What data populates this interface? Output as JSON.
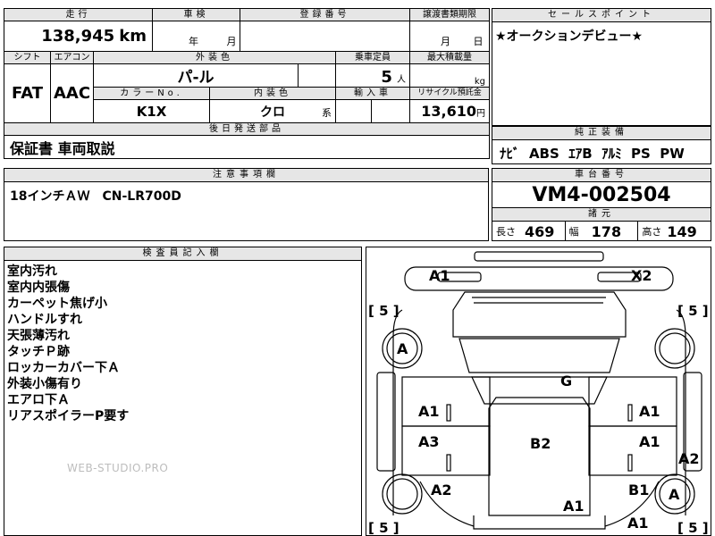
{
  "vehicle": {
    "mileage_label": "走行",
    "mileage_value": "138,945",
    "mileage_unit": "km",
    "inspection_label": "車検",
    "inspection_year_unit": "年",
    "inspection_month_unit": "月",
    "registration_label": "登録番号",
    "transfer_label": "譲渡書類期限",
    "transfer_month_unit": "月",
    "transfer_day_unit": "日",
    "shift_label": "シフト",
    "shift_value": "FAT",
    "ac_label": "エアコン",
    "ac_value": "AAC",
    "exterior_color_label": "外装色",
    "exterior_color_value": "パ-ル",
    "capacity_label": "乗車定員",
    "capacity_value": "5",
    "capacity_unit": "人",
    "max_load_label": "最大積載量",
    "max_load_unit": "kg",
    "color_no_label": "カラーNo.",
    "color_no_value": "K1X",
    "interior_label": "内装色",
    "interior_value": "クロ",
    "interior_suffix": "系",
    "import_label": "輸入車",
    "recycle_label": "リサイクル預託金",
    "recycle_value": "13,610",
    "recycle_unit": "円",
    "later_parts_label": "後日発送部品",
    "later_parts_value": "保証書 車両取説",
    "notes_label": "注意事項欄",
    "notes_value": "18インチＡＷ　CN-LR700D"
  },
  "sales_point": {
    "label": "セールスポイント",
    "text": "★オークションデビュー★"
  },
  "equipment": {
    "label": "純正装備",
    "text": "ﾅﾋﾞ  ABS  ｴｱB  ｱﾙﾐ  PS  PW"
  },
  "chassis": {
    "label": "車台番号",
    "value": "VM4-002504"
  },
  "dimensions": {
    "label": "諸元",
    "length_label": "長さ",
    "length_value": "469",
    "width_label": "幅",
    "width_value": "178",
    "height_label": "高さ",
    "height_value": "149"
  },
  "inspector": {
    "label": "検査員記入欄",
    "lines": [
      "室内汚れ",
      "室内内張傷",
      "カーペット焦げ小",
      "ハンドルすれ",
      "天張薄汚れ",
      "タッチＰ跡",
      "ロッカーカバー下Ａ",
      "外装小傷有り",
      "エアロ下Ａ",
      "リアスポイラーP要す"
    ],
    "watermark": "WEB-STUDIO.PRO"
  },
  "damage_map": {
    "front_left": "A1",
    "front_right": "X2",
    "tire_bracket": "[ 5 ]",
    "left_front_wheel": "A",
    "hood": "G",
    "left_front_door": "A1",
    "right_front_door": "A1",
    "left_rear_door": "A3",
    "right_rear_door": "A1",
    "roof": "B2",
    "right_rear_side": "A2",
    "left_rear_fender": "A2",
    "right_rear_fender": "B1",
    "right_rear_wheel": "A",
    "trunk": "A1",
    "rear_right": "A1"
  }
}
